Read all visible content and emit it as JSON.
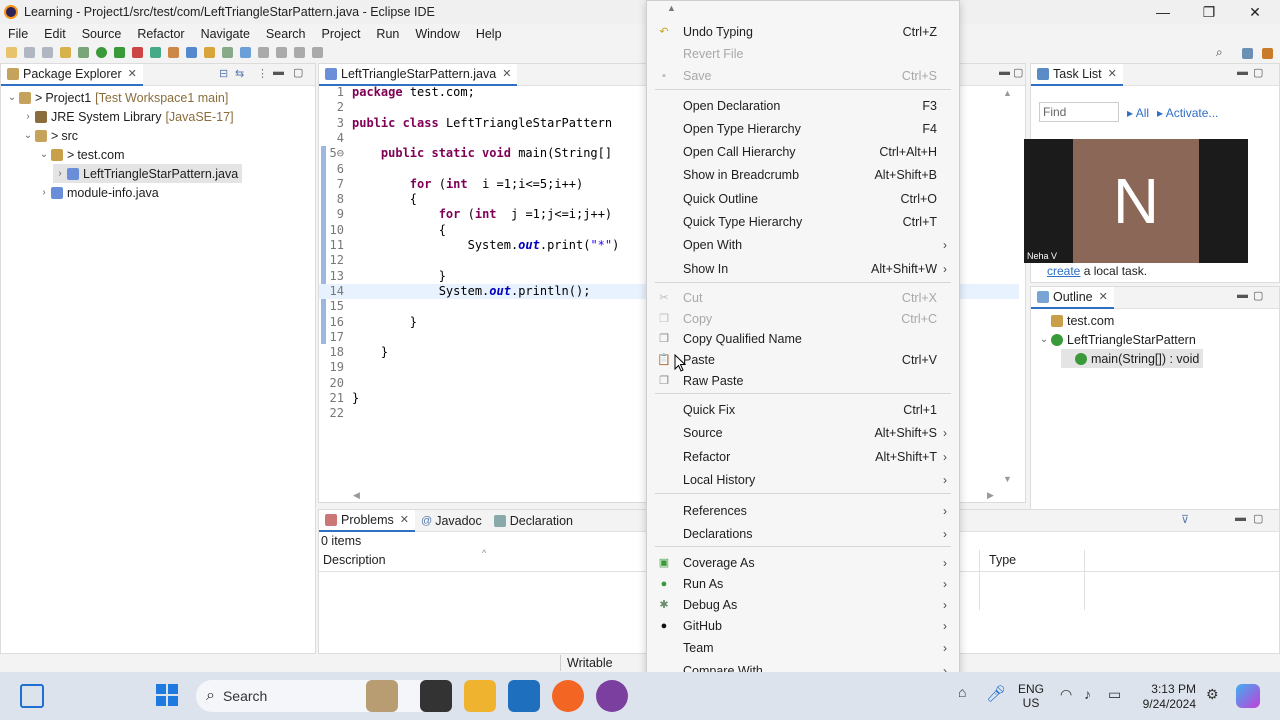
{
  "window": {
    "title": "Learning - Project1/src/test/com/LeftTriangleStarPattern.java - Eclipse IDE",
    "minimize": "—",
    "maximize": "❐",
    "close": "✕"
  },
  "menubar": [
    "File",
    "Edit",
    "Source",
    "Refactor",
    "Navigate",
    "Search",
    "Project",
    "Run",
    "Window",
    "Help"
  ],
  "package_explorer": {
    "tab": "Package Explorer",
    "tree": [
      {
        "label": "Project1",
        "decor": "[Test Workspace1 main]",
        "twisty": "⌄",
        "prefix": ">",
        "indent": 0
      },
      {
        "label": "JRE System Library",
        "decor": "[JavaSE-17]",
        "twisty": "›",
        "indent": 1
      },
      {
        "label": "src",
        "twisty": "⌄",
        "prefix": ">",
        "indent": 1
      },
      {
        "label": "test.com",
        "twisty": "⌄",
        "prefix": ">",
        "indent": 2
      },
      {
        "label": "LeftTriangleStarPattern.java",
        "twisty": "›",
        "indent": 3,
        "selected": true
      },
      {
        "label": "module-info.java",
        "twisty": "›",
        "indent": 2
      }
    ]
  },
  "editor": {
    "tab": "LeftTriangleStarPattern.java",
    "lines": [
      {
        "n": "1",
        "parts": [
          [
            "kw",
            "package"
          ],
          [
            "",
            "test.com;"
          ]
        ]
      },
      {
        "n": "2",
        "parts": []
      },
      {
        "n": "3",
        "parts": [
          [
            "kw",
            "public class"
          ],
          [
            "",
            "LeftTriangleStarPattern"
          ]
        ]
      },
      {
        "n": "4",
        "parts": []
      },
      {
        "n": "5⊖",
        "parts": [
          [
            "",
            "    "
          ],
          [
            "kw",
            "public static void"
          ],
          [
            "",
            "main(String[]"
          ]
        ]
      },
      {
        "n": "6",
        "parts": []
      },
      {
        "n": "7",
        "parts": [
          [
            "",
            "        "
          ],
          [
            "kw",
            "for"
          ],
          [
            "",
            "("
          ],
          [
            "kw",
            "int"
          ],
          [
            "",
            " i =1;i<=5;i++)"
          ]
        ]
      },
      {
        "n": "8",
        "parts": [
          [
            "",
            "        {"
          ]
        ]
      },
      {
        "n": "9",
        "parts": [
          [
            "",
            "            "
          ],
          [
            "kw",
            "for"
          ],
          [
            "",
            "("
          ],
          [
            "kw",
            "int"
          ],
          [
            "",
            " j =1;j<=i;j++)"
          ]
        ]
      },
      {
        "n": "10",
        "parts": [
          [
            "",
            "            {"
          ]
        ]
      },
      {
        "n": "11",
        "parts": [
          [
            "",
            "                System."
          ],
          [
            "fld",
            "out"
          ],
          [
            "",
            ".print("
          ],
          [
            "str",
            "\"*\""
          ],
          [
            "",
            ")"
          ]
        ]
      },
      {
        "n": "12",
        "parts": []
      },
      {
        "n": "13",
        "parts": [
          [
            "",
            "            }"
          ]
        ]
      },
      {
        "n": "14",
        "parts": [
          [
            "",
            "            System."
          ],
          [
            "fld",
            "out"
          ],
          [
            "",
            ".println();"
          ]
        ]
      },
      {
        "n": "15",
        "parts": []
      },
      {
        "n": "16",
        "parts": [
          [
            "",
            "        }"
          ]
        ]
      },
      {
        "n": "17",
        "parts": []
      },
      {
        "n": "18",
        "parts": [
          [
            "",
            "    }"
          ]
        ]
      },
      {
        "n": "19",
        "parts": []
      },
      {
        "n": "20",
        "parts": []
      },
      {
        "n": "21",
        "parts": [
          [
            "",
            "}"
          ]
        ]
      },
      {
        "n": "22",
        "parts": []
      }
    ]
  },
  "context_menu": {
    "items": [
      {
        "label": "Undo Typing",
        "key": "Ctrl+Z",
        "icon": "undo-icon",
        "glyph": "↶",
        "color": "#c9a21a"
      },
      {
        "label": "Revert File",
        "disabled": true
      },
      {
        "label": "Save",
        "key": "Ctrl+S",
        "disabled": true,
        "icon": "save-icon",
        "glyph": "▪",
        "color": "#bbbbbb"
      },
      {
        "sep": true
      },
      {
        "label": "Open Declaration",
        "key": "F3"
      },
      {
        "label": "Open Type Hierarchy",
        "key": "F4"
      },
      {
        "label": "Open Call Hierarchy",
        "key": "Ctrl+Alt+H"
      },
      {
        "label": "Show in Breadcrumb",
        "key": "Alt+Shift+B"
      },
      {
        "label": "Quick Outline",
        "key": "Ctrl+O"
      },
      {
        "label": "Quick Type Hierarchy",
        "key": "Ctrl+T"
      },
      {
        "label": "Open With",
        "submenu": true
      },
      {
        "label": "Show In",
        "key": "Alt+Shift+W",
        "submenu": true
      },
      {
        "sep": true
      },
      {
        "label": "Cut",
        "key": "Ctrl+X",
        "disabled": true,
        "icon": "cut-icon",
        "glyph": "✂",
        "color": "#bbbbbb"
      },
      {
        "label": "Copy",
        "key": "Ctrl+C",
        "disabled": true,
        "icon": "copy-icon",
        "glyph": "❐",
        "color": "#bbbbbb"
      },
      {
        "label": "Copy Qualified Name",
        "icon": "copy-qualified-icon",
        "glyph": "❐",
        "color": "#888888"
      },
      {
        "label": "Paste",
        "key": "Ctrl+V",
        "icon": "paste-icon",
        "glyph": "📋",
        "color": "#888888"
      },
      {
        "label": "Raw Paste",
        "icon": "raw-paste-icon",
        "glyph": "❐",
        "color": "#888888"
      },
      {
        "sep": true
      },
      {
        "label": "Quick Fix",
        "key": "Ctrl+1"
      },
      {
        "label": "Source",
        "key": "Alt+Shift+S",
        "submenu": true
      },
      {
        "label": "Refactor",
        "key": "Alt+Shift+T",
        "submenu": true
      },
      {
        "label": "Local History",
        "submenu": true
      },
      {
        "sep": true
      },
      {
        "label": "References",
        "submenu": true
      },
      {
        "label": "Declarations",
        "submenu": true
      },
      {
        "sep": true
      },
      {
        "label": "Coverage As",
        "submenu": true,
        "icon": "coverage-icon",
        "glyph": "▣",
        "color": "#3a9a3a"
      },
      {
        "label": "Run As",
        "submenu": true,
        "icon": "run-icon",
        "glyph": "●",
        "color": "#3a9a3a"
      },
      {
        "label": "Debug As",
        "submenu": true,
        "icon": "debug-icon",
        "glyph": "✱",
        "color": "#6a8a6a"
      },
      {
        "label": "GitHub",
        "submenu": true,
        "icon": "github-icon",
        "glyph": "●",
        "color": "#111111"
      },
      {
        "label": "Team",
        "submenu": true
      },
      {
        "label": "Compare With",
        "submenu": true
      }
    ],
    "submenu_arrow": "›",
    "scroll_up": "▲",
    "scroll_down": "▼"
  },
  "task_list": {
    "tab": "Task List",
    "find_placeholder": "Find",
    "all": "All",
    "activate": "Activate...",
    "create_link": "create",
    "create_rest": " a local task."
  },
  "video": {
    "initial": "N",
    "name": "Neha V"
  },
  "outline": {
    "tab": "Outline",
    "items": [
      {
        "label": "test.com",
        "indent": 0
      },
      {
        "label": "LeftTriangleStarPattern",
        "indent": 0,
        "twisty": "⌄"
      },
      {
        "label": "main(String[]) : void",
        "indent": 1,
        "selected": true
      }
    ]
  },
  "problems": {
    "tabs": [
      "Problems",
      "Javadoc",
      "Declaration"
    ],
    "count": "0 items",
    "columns": [
      "Description",
      "Type"
    ]
  },
  "status": {
    "writable": "Writable"
  },
  "taskbar": {
    "search": "Search",
    "lang": "ENG",
    "region": "US",
    "time": "3:13 PM",
    "date": "9/24/2024"
  }
}
